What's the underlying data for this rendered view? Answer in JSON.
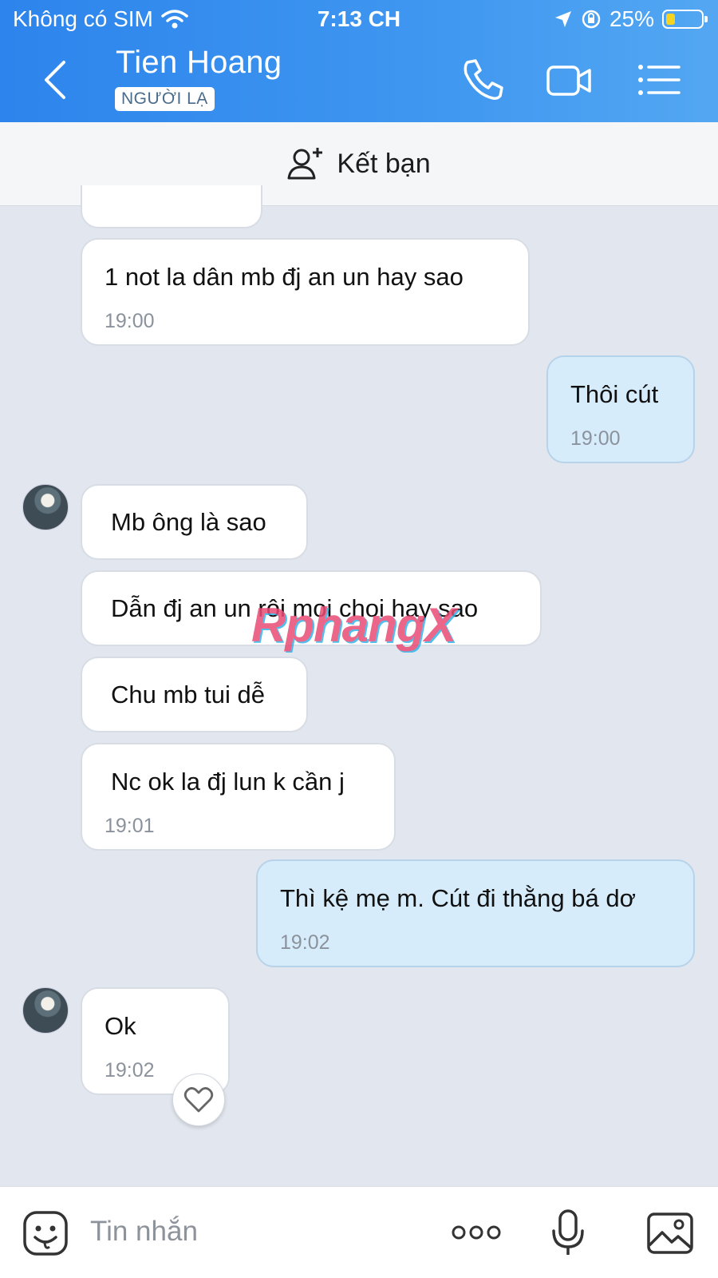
{
  "status_bar": {
    "carrier": "Không có SIM",
    "time": "7:13 CH",
    "battery": "25%",
    "battery_level": 0.25
  },
  "header": {
    "contact_name": "Tien Hoang",
    "badge": "NGƯỜI LẠ",
    "icons": [
      "back-icon",
      "phone-icon",
      "video-icon",
      "menu-icon"
    ]
  },
  "friend_bar": {
    "label": "Kết bạn",
    "icon": "add-person-icon"
  },
  "messages": [
    {
      "side": "received",
      "text": "1 not la dân mb đj an un hay  sao",
      "time": "19:00"
    },
    {
      "side": "sent",
      "text": "Thôi cút",
      "time": "19:00"
    },
    {
      "side": "received",
      "text": "Mb ông là sao",
      "time": ""
    },
    {
      "side": "received",
      "text": "Dẫn đj an un rôi moi choi hay sao",
      "time": ""
    },
    {
      "side": "received",
      "text": "Chu mb tui dễ",
      "time": ""
    },
    {
      "side": "received",
      "text": "Nc ok la đj lun k cần j",
      "time": "19:01"
    },
    {
      "side": "sent",
      "text": "Thì kệ mẹ m. Cút đi thằng bá dơ",
      "time": "19:02"
    },
    {
      "side": "received",
      "text": "Ok",
      "time": "19:02"
    }
  ],
  "watermark": "RphangX",
  "input_bar": {
    "placeholder": "Tin nhắn",
    "icons": [
      "sticker-icon",
      "more-icon",
      "microphone-icon",
      "image-icon"
    ]
  },
  "colors": {
    "header_start": "#2d84ec",
    "header_end": "#53a7f2",
    "sent_bubble": "#d7ecfb",
    "received_bubble": "#ffffff",
    "chat_background": "#e2e6ee"
  }
}
